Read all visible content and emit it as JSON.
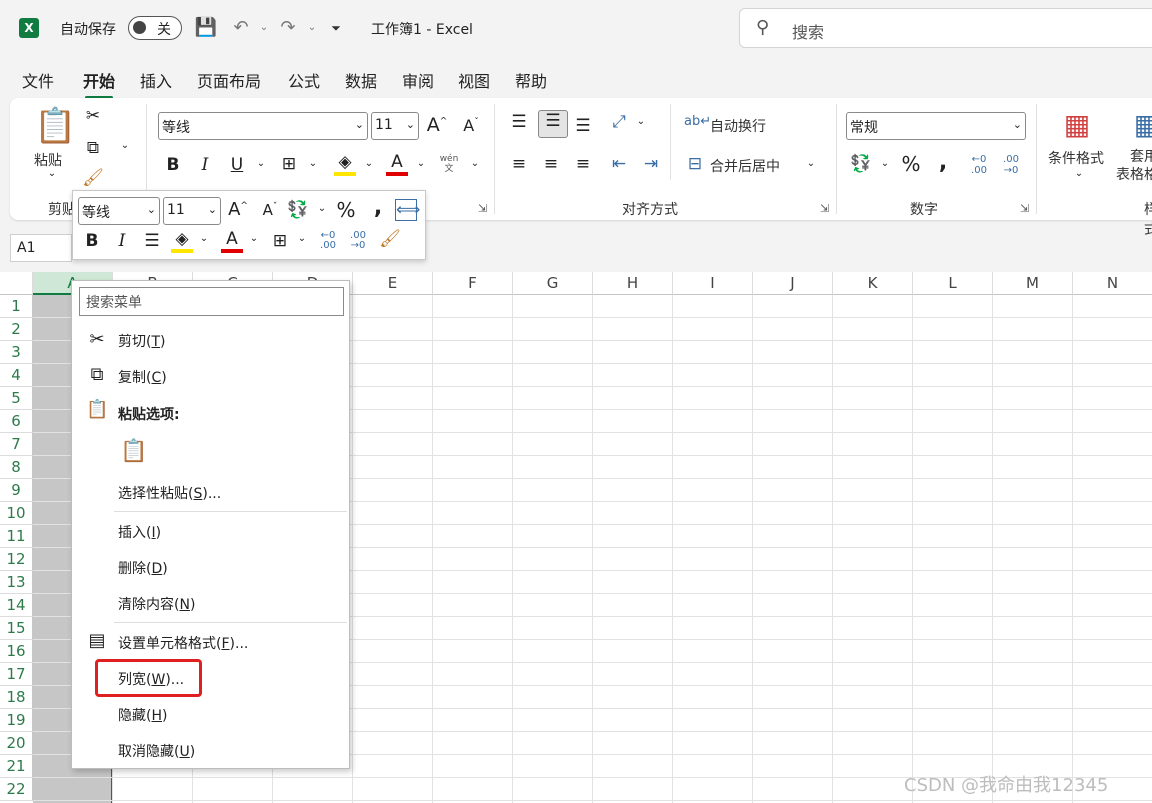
{
  "titlebar": {
    "app_logo": "X",
    "autosave_label": "自动保存",
    "autosave_state": "关",
    "document_title": "工作簿1  -  Excel",
    "search_placeholder": "搜索"
  },
  "tabs": [
    {
      "label": "文件",
      "active": false
    },
    {
      "label": "开始",
      "active": true
    },
    {
      "label": "插入",
      "active": false
    },
    {
      "label": "页面布局",
      "active": false
    },
    {
      "label": "公式",
      "active": false
    },
    {
      "label": "数据",
      "active": false
    },
    {
      "label": "审阅",
      "active": false
    },
    {
      "label": "视图",
      "active": false
    },
    {
      "label": "帮助",
      "active": false
    }
  ],
  "ribbon": {
    "clipboard": {
      "paste_label": "粘贴",
      "group_label": "剪贴板"
    },
    "font": {
      "font_name": "等线",
      "font_size": "11",
      "phonetic_label": "wén\n文"
    },
    "alignment": {
      "wrap_text": "自动换行",
      "merge_center": "合并后居中",
      "group_label": "对齐方式"
    },
    "number": {
      "format": "常规",
      "group_label": "数字"
    },
    "styles": {
      "conditional_format": "条件格式",
      "table_format": "套用\n表格格式",
      "group_label": "样式"
    }
  },
  "minibar": {
    "font_name": "等线",
    "font_size": "11"
  },
  "formula_bar": {
    "name_box": "A1"
  },
  "grid": {
    "columns": [
      "A",
      "B",
      "C",
      "D",
      "E",
      "F",
      "G",
      "H",
      "I",
      "J",
      "K",
      "L",
      "M",
      "N"
    ],
    "rows": [
      "1",
      "2",
      "3",
      "4",
      "5",
      "6",
      "7",
      "8",
      "9",
      "10",
      "11",
      "12",
      "13",
      "14",
      "15",
      "16",
      "17",
      "18",
      "19",
      "20",
      "21",
      "22"
    ],
    "selected_column": "A"
  },
  "context_menu": {
    "search_placeholder": "搜索菜单",
    "cut": "剪切(",
    "cut_key": "T",
    "copy": "复制(",
    "copy_key": "C",
    "paste_options": "粘贴选项:",
    "paste_special": "选择性粘贴(",
    "paste_special_key": "S",
    "paste_special_tail": ")...",
    "insert": "插入(",
    "insert_key": "I",
    "delete": "删除(",
    "delete_key": "D",
    "clear_contents": "清除内容(",
    "clear_key": "N",
    "format_cells": "设置单元格格式(",
    "format_key": "F",
    "format_tail": ")...",
    "column_width": "列宽(",
    "column_width_key": "W",
    "column_width_tail": ")...",
    "hide": "隐藏(",
    "hide_key": "H",
    "unhide": "取消隐藏(",
    "unhide_key": "U",
    "close_paren": ")"
  },
  "watermark": "CSDN @我命由我12345",
  "colors": {
    "accent": "#107c41",
    "highlight_box": "#e02020"
  }
}
